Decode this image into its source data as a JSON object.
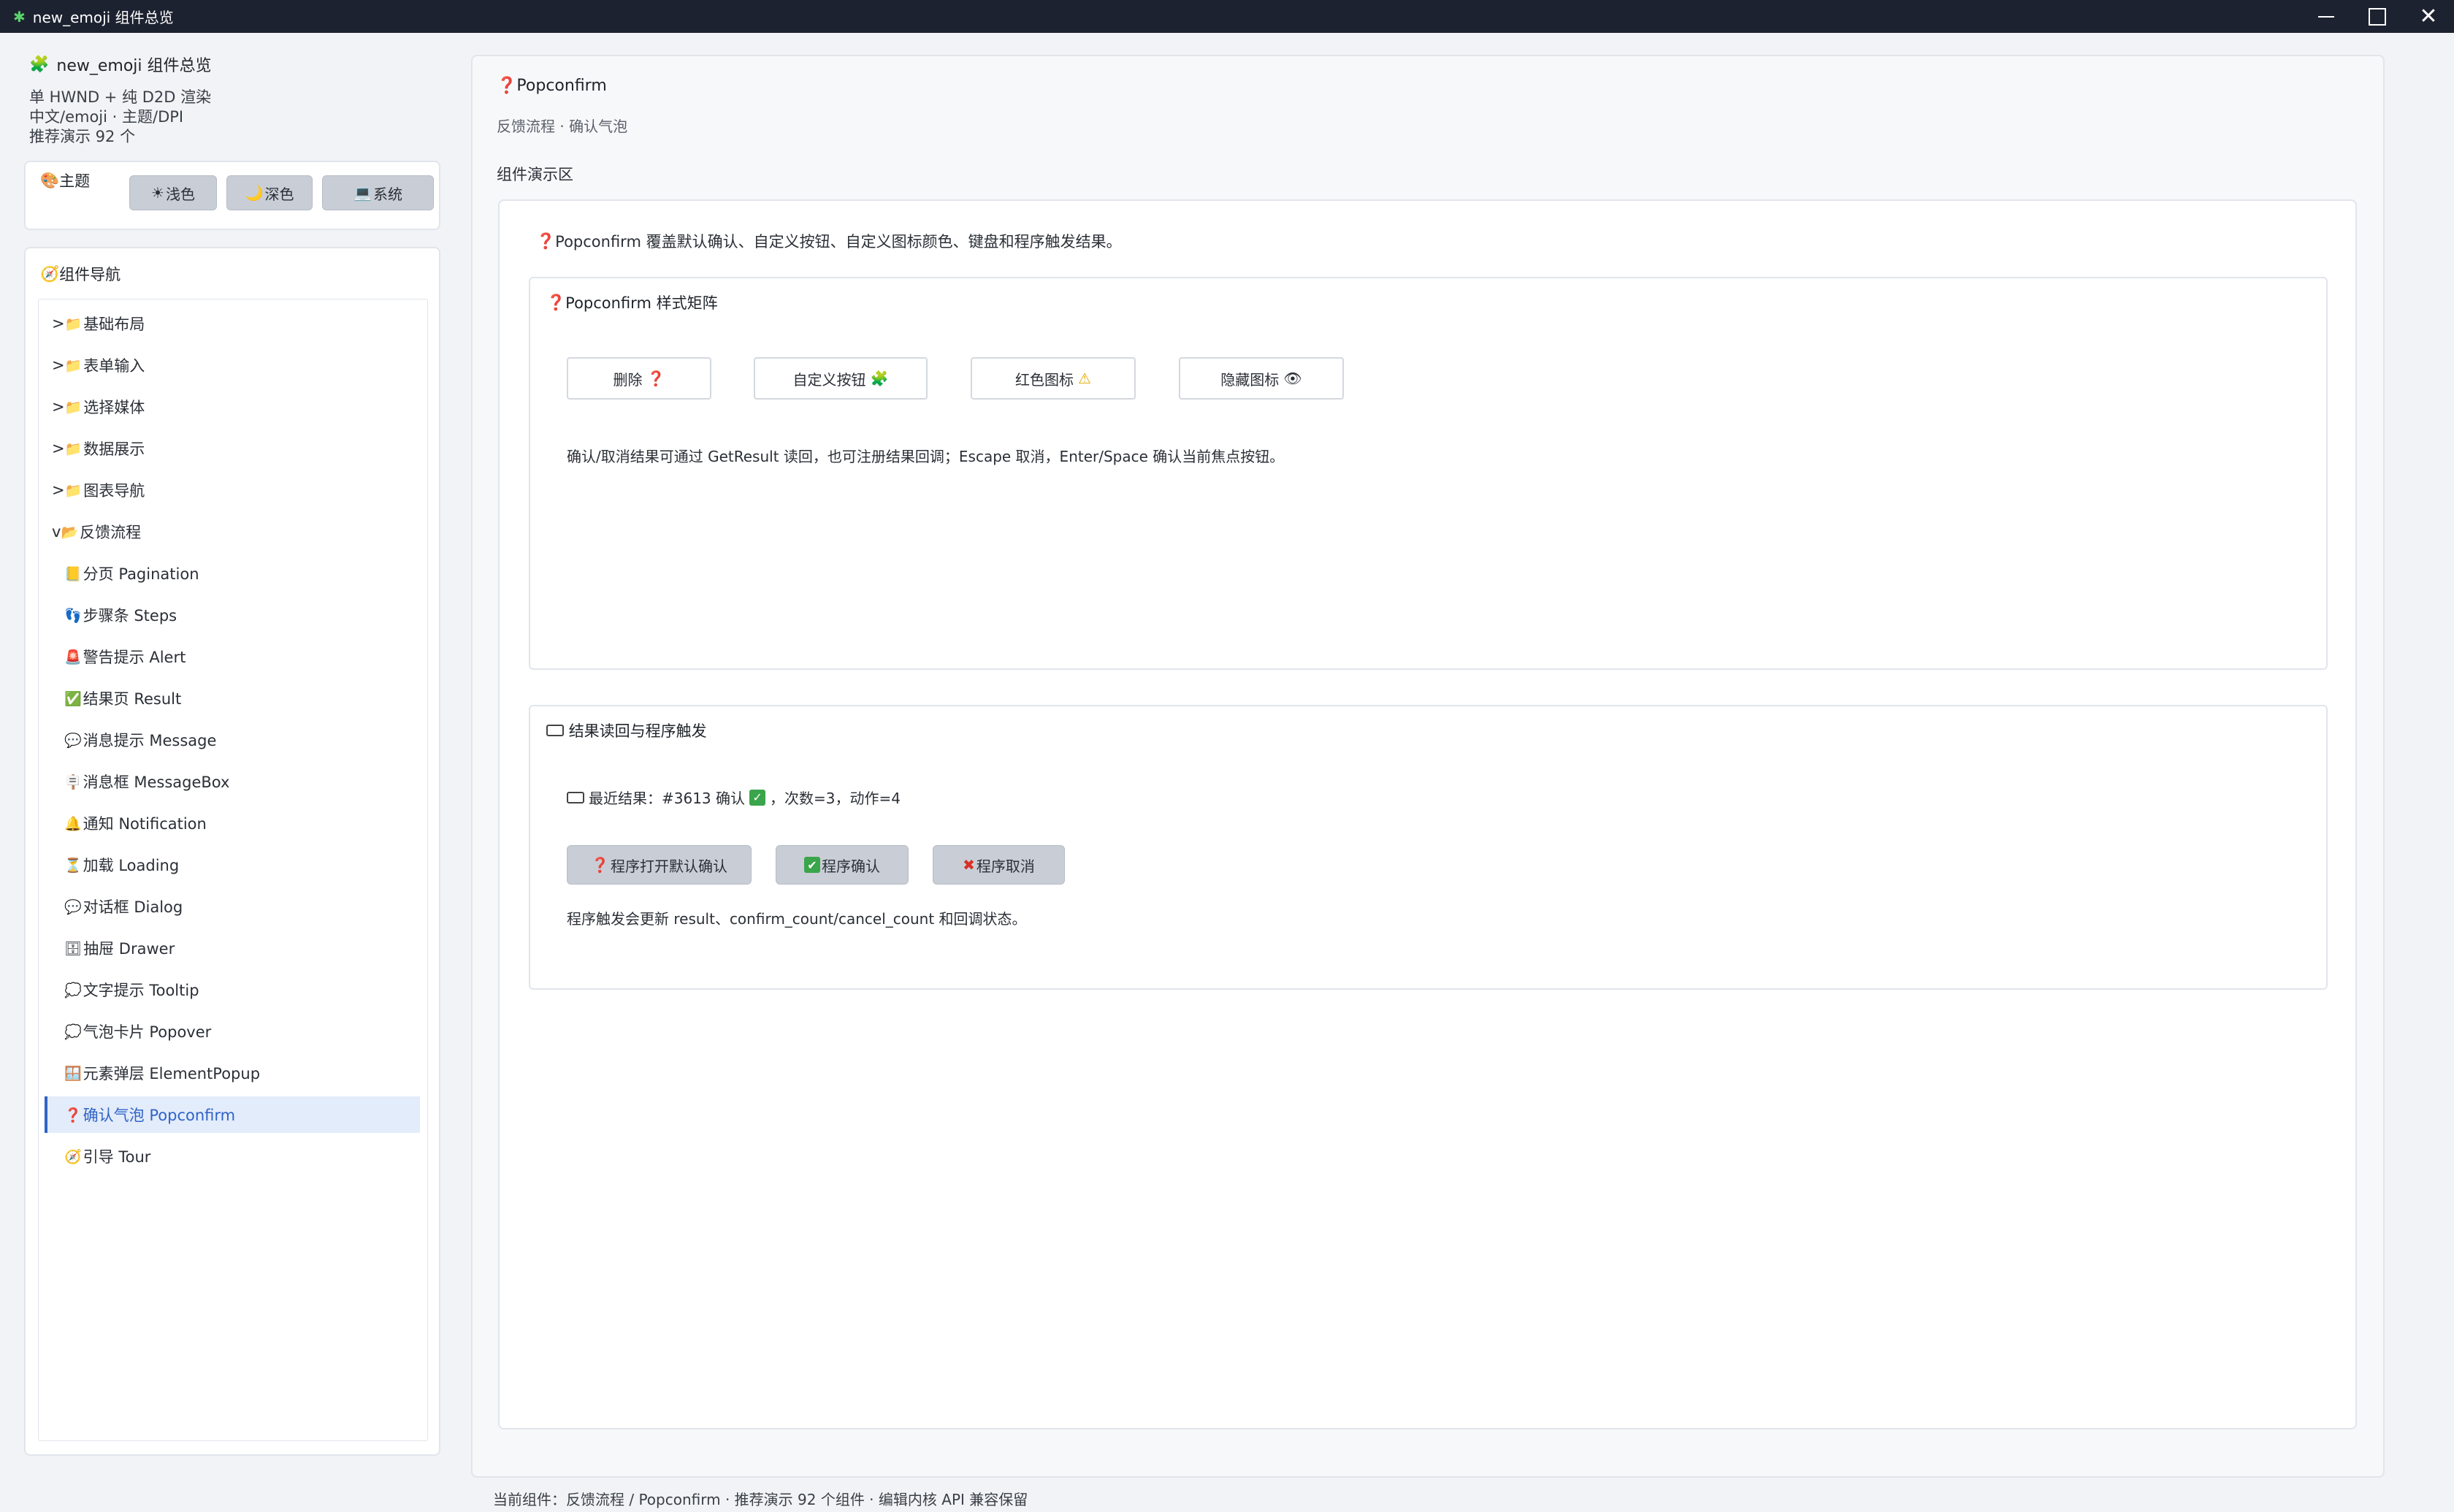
{
  "window": {
    "title": "new_emoji 组件总览"
  },
  "sidebar": {
    "app_title": "new_emoji 组件总览",
    "info_lines": [
      "单 HWND + 纯 D2D 渲染",
      "中文/emoji · 主题/DPI",
      "推荐演示 92 个"
    ],
    "theme": {
      "label": "主题",
      "buttons": [
        {
          "icon": "☀",
          "label": "浅色"
        },
        {
          "icon": "🌙",
          "label": "深色"
        },
        {
          "icon": "💻",
          "label": "系统"
        }
      ]
    },
    "nav": {
      "label": "组件导航",
      "groups": [
        {
          "prefix": ">",
          "label": "基础布局"
        },
        {
          "prefix": ">",
          "label": "表单输入"
        },
        {
          "prefix": ">",
          "label": "选择媒体"
        },
        {
          "prefix": ">",
          "label": "数据展示"
        },
        {
          "prefix": ">",
          "label": "图表导航"
        },
        {
          "prefix": "v",
          "label": "反馈流程"
        }
      ],
      "items": [
        {
          "icon": "📒",
          "label": "分页 Pagination"
        },
        {
          "icon": "👣",
          "label": "步骤条 Steps"
        },
        {
          "icon": "🚨",
          "label": "警告提示 Alert"
        },
        {
          "icon": "✅",
          "label": "结果页 Result"
        },
        {
          "icon": "💬",
          "label": "消息提示 Message"
        },
        {
          "icon": "🪧",
          "label": "消息框 MessageBox"
        },
        {
          "icon": "🔔",
          "label": "通知 Notification"
        },
        {
          "icon": "⏳",
          "label": "加载 Loading"
        },
        {
          "icon": "💬",
          "label": "对话框 Dialog"
        },
        {
          "icon": "🗄",
          "label": "抽屉 Drawer"
        },
        {
          "icon": "💭",
          "label": "文字提示 Tooltip"
        },
        {
          "icon": "💭",
          "label": "气泡卡片 Popover"
        },
        {
          "icon": "🪟",
          "label": "元素弹层 ElementPopup"
        },
        {
          "icon": "❓",
          "label": "确认气泡 Popconfirm"
        },
        {
          "icon": "🧭",
          "label": "引导 Tour"
        }
      ],
      "active_index": 13
    }
  },
  "main": {
    "title": "Popconfirm",
    "subtitle": "反馈流程 · 确认气泡",
    "area_label": "组件演示区",
    "intro": "Popconfirm 覆盖默认确认、自定义按钮、自定义图标颜色、键盘和程序触发结果。",
    "card1": {
      "title": "Popconfirm 样式矩阵",
      "buttons": [
        {
          "label": "删除",
          "icon": "❓"
        },
        {
          "label": "自定义按钮",
          "icon": "🧩"
        },
        {
          "label": "红色图标",
          "icon": "⚠"
        },
        {
          "label": "隐藏图标",
          "icon": "👁"
        }
      ],
      "desc": "确认/取消结果可通过 GetResult 读回，也可注册结果回调；Escape 取消，Enter/Space 确认当前焦点按钮。"
    },
    "card2": {
      "title": "结果读回与程序触发",
      "result_prefix": "最近结果：#3613 确认",
      "result_suffix": "，次数=3，动作=4",
      "buttons": [
        {
          "icon": "❓",
          "label": "程序打开默认确认"
        },
        {
          "icon": "✔",
          "label": "程序确认"
        },
        {
          "icon": "✖",
          "label": "程序取消"
        }
      ],
      "desc": "程序触发会更新 result、confirm_count/cancel_count 和回调状态。"
    }
  },
  "status_bar": "当前组件：反馈流程 / Popconfirm · 推荐演示 92 个组件 · 编辑内核 API 兼容保留",
  "colors": {
    "accent": "#2f63c7",
    "titlebar": "#1d2230"
  }
}
